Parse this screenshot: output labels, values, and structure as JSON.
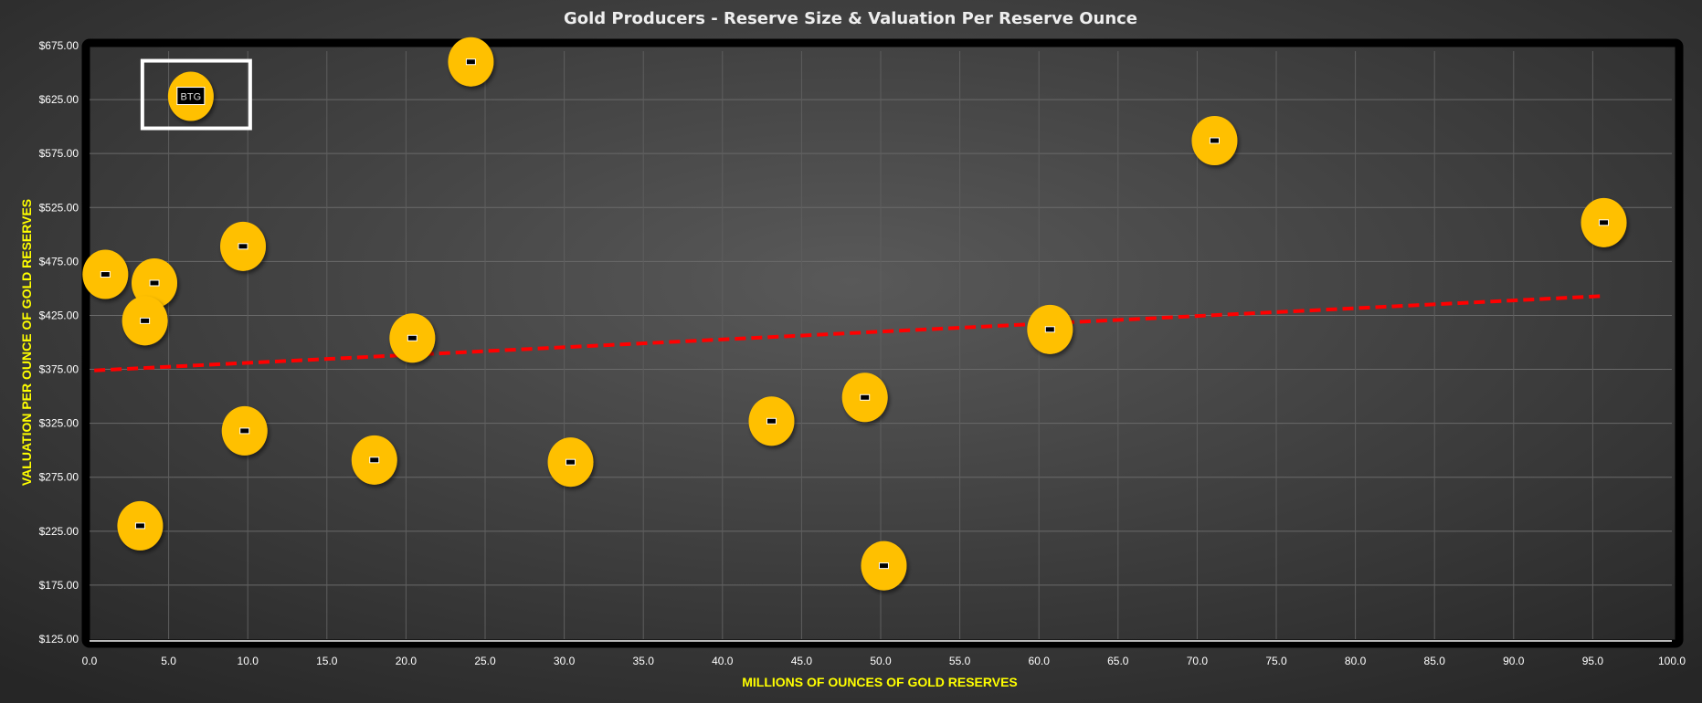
{
  "chart_data": {
    "type": "scatter",
    "title": "Gold Producers - Reserve Size & Valuation Per Reserve Ounce",
    "xlabel": "MILLIONS OF OUNCES OF GOLD RESERVES",
    "ylabel": "VALUATION PER OUNCE OF GOLD RESERVES",
    "xlim": [
      0,
      100
    ],
    "ylim": [
      125,
      675
    ],
    "x_ticks": [
      "0.0",
      "5.0",
      "10.0",
      "15.0",
      "20.0",
      "25.0",
      "30.0",
      "35.0",
      "40.0",
      "45.0",
      "50.0",
      "55.0",
      "60.0",
      "65.0",
      "70.0",
      "75.0",
      "80.0",
      "85.0",
      "90.0",
      "95.0",
      "100.0"
    ],
    "y_ticks": [
      "$125.00",
      "$175.00",
      "$225.00",
      "$275.00",
      "$325.00",
      "$375.00",
      "$425.00",
      "$475.00",
      "$525.00",
      "$575.00",
      "$625.00",
      "$675.00"
    ],
    "grid": true,
    "colors": {
      "point": "#FFC000",
      "trend": "#FF0000",
      "background": "#3a3a3a",
      "frame": "#000000",
      "highlight": "#FFFFFF"
    },
    "points": [
      {
        "x": 6.4,
        "y": 628,
        "label": "BTG",
        "highlight": true
      },
      {
        "x": 24.1,
        "y": 660,
        "label": ""
      },
      {
        "x": 71.1,
        "y": 587,
        "label": ""
      },
      {
        "x": 95.7,
        "y": 511,
        "label": ""
      },
      {
        "x": 1.0,
        "y": 463,
        "label": ""
      },
      {
        "x": 4.1,
        "y": 455,
        "label": ""
      },
      {
        "x": 9.7,
        "y": 489,
        "label": ""
      },
      {
        "x": 3.5,
        "y": 420,
        "label": ""
      },
      {
        "x": 20.4,
        "y": 404,
        "label": ""
      },
      {
        "x": 60.7,
        "y": 412,
        "label": ""
      },
      {
        "x": 49.0,
        "y": 349,
        "label": ""
      },
      {
        "x": 43.1,
        "y": 327,
        "label": ""
      },
      {
        "x": 9.8,
        "y": 318,
        "label": ""
      },
      {
        "x": 18.0,
        "y": 291,
        "label": ""
      },
      {
        "x": 30.4,
        "y": 289,
        "label": ""
      },
      {
        "x": 3.2,
        "y": 230,
        "label": ""
      },
      {
        "x": 50.2,
        "y": 193,
        "label": ""
      }
    ],
    "trendline": {
      "type": "linear",
      "x": [
        0.3,
        95.7
      ],
      "y": [
        374,
        443
      ]
    }
  }
}
